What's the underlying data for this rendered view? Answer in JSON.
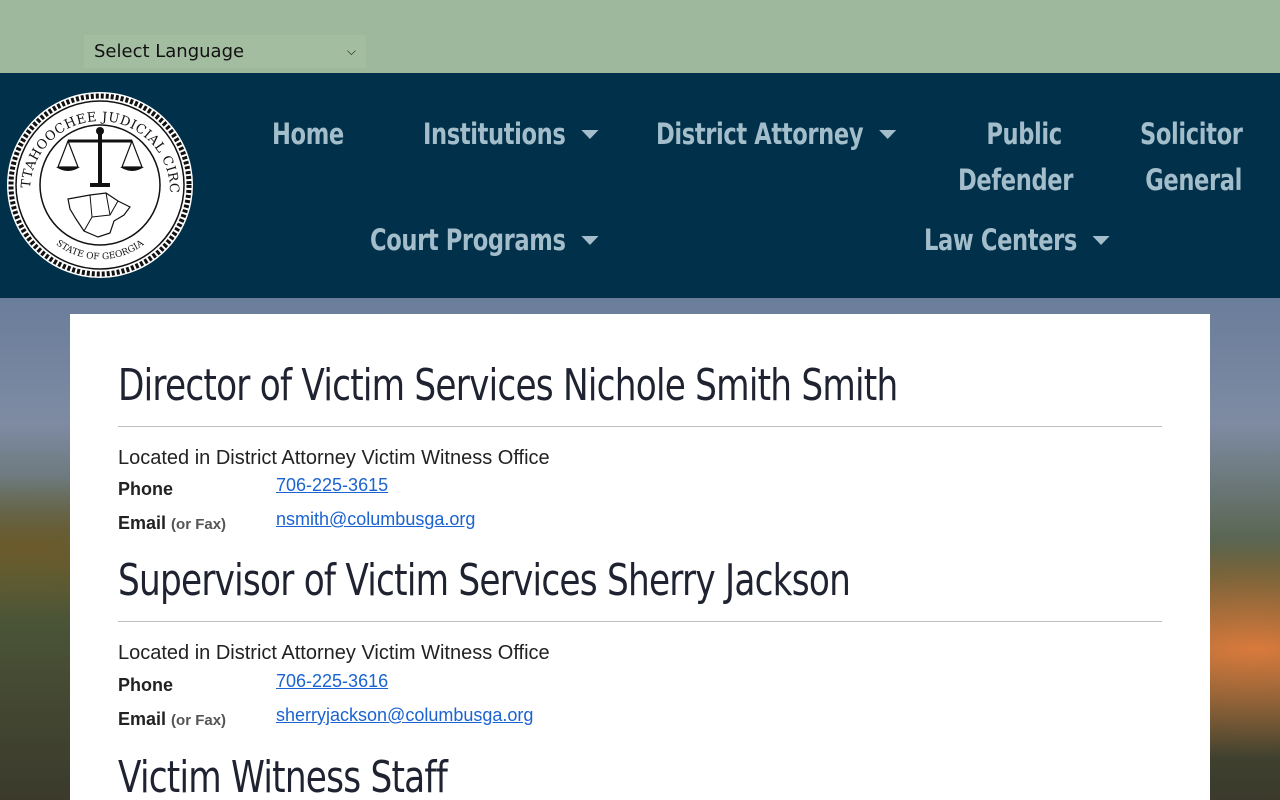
{
  "language": {
    "selected": "Select Language"
  },
  "logo": {
    "text_top": "CHATTAHOOCHEE JUDICIAL CIRCUIT",
    "text_bottom": "STATE OF GEORGIA"
  },
  "nav": {
    "home": "Home",
    "institutions": "Institutions",
    "district_attorney": "District Attorney",
    "public_defender_1": "Public",
    "public_defender_2": "Defender",
    "solicitor_general_1": "Solicitor",
    "solicitor_general_2": "General",
    "court_programs": "Court Programs",
    "law_centers": "Law Centers"
  },
  "sections": [
    {
      "title": "Director of Victim Services Nichole Smith Smith",
      "location": "Located in District Attorney Victim Witness Office",
      "phone_label": "Phone",
      "phone": "706-225-3615",
      "email_label": "Email",
      "email_sub": "(or Fax)",
      "email": "nsmith@columbusga.org"
    },
    {
      "title": "Supervisor of Victim Services Sherry Jackson",
      "location": "Located in District Attorney Victim Witness Office",
      "phone_label": "Phone",
      "phone": "706-225-3616",
      "email_label": "Email",
      "email_sub": "(or Fax)",
      "email": "sherryjackson@columbusga.org"
    },
    {
      "title": "Victim Witness Staff"
    }
  ],
  "colors": {
    "topbar": "#9eb89d",
    "header": "#00304a",
    "nav_text": "#a3bdca",
    "link": "#1a63d1"
  }
}
